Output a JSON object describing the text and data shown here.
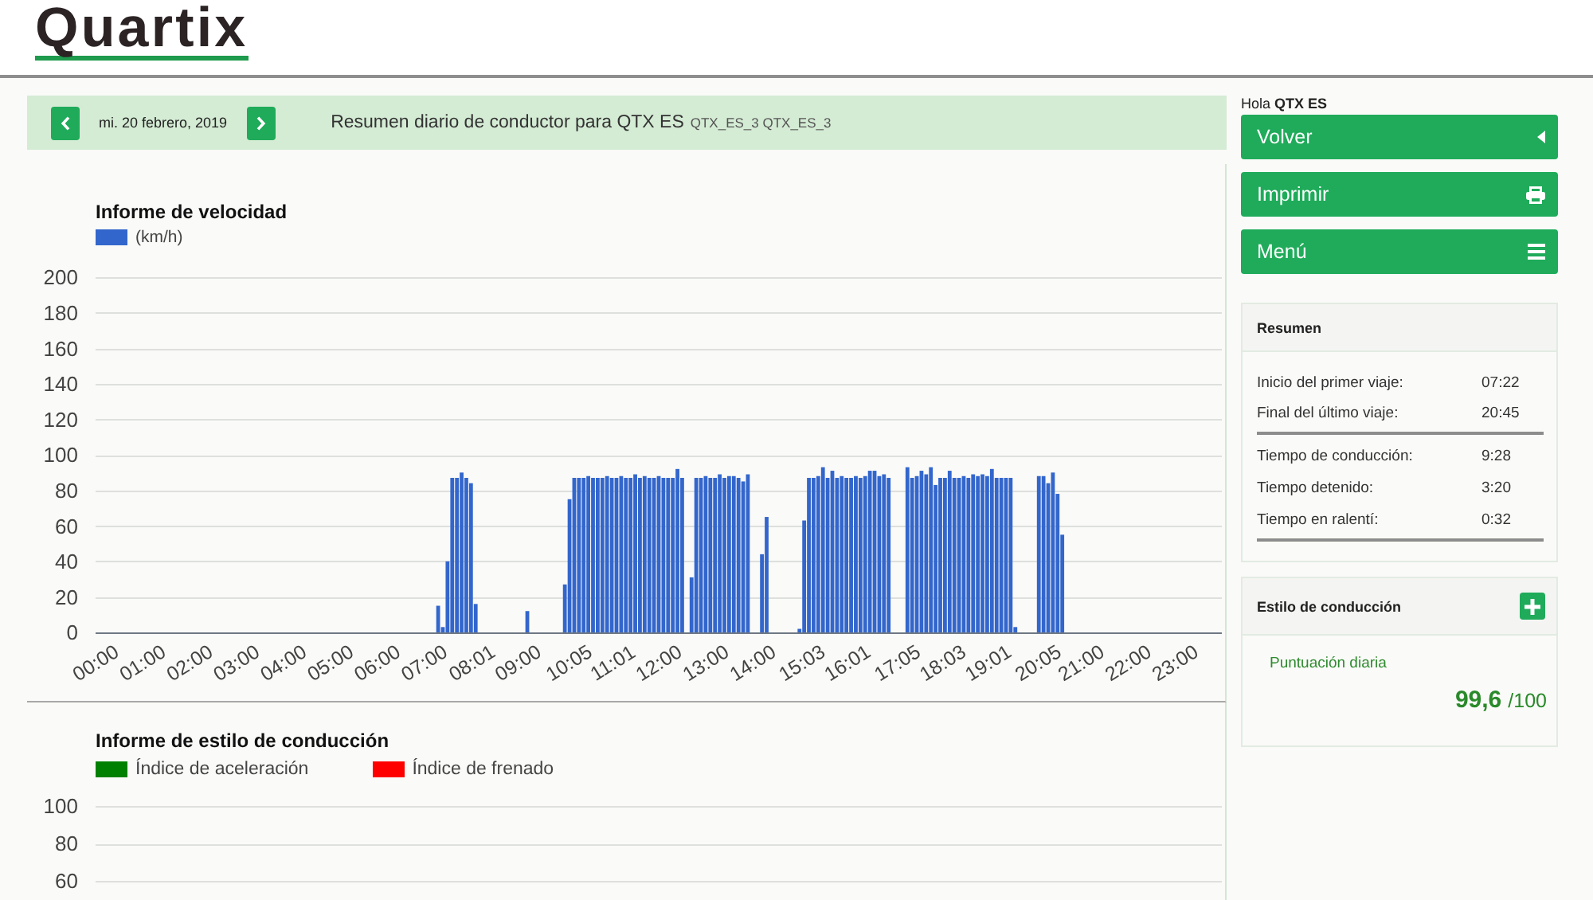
{
  "header": {
    "logo": "Quartix"
  },
  "day_bar": {
    "date": "mi. 20 febrero, 2019",
    "title": "Resumen diario de conductor para QTX ES",
    "subtitle": "QTX_ES_3 QTX_ES_3"
  },
  "speed_chart": {
    "chart_data": {
      "type": "bar",
      "title": "Informe de velocidad",
      "x": [
        7.3,
        7.4,
        7.5,
        7.6,
        7.7,
        7.8,
        7.9,
        8.0,
        8.1,
        9.2,
        10.0,
        10.1,
        10.2,
        10.3,
        10.4,
        10.5,
        10.6,
        10.7,
        10.8,
        10.9,
        11.0,
        11.1,
        11.2,
        11.3,
        11.4,
        11.5,
        11.6,
        11.7,
        11.8,
        11.9,
        12.0,
        12.1,
        12.2,
        12.3,
        12.4,
        12.5,
        12.7,
        12.8,
        12.9,
        13.0,
        13.1,
        13.2,
        13.3,
        13.4,
        13.5,
        13.6,
        13.7,
        13.8,
        13.9,
        14.2,
        14.3,
        15.0,
        15.1,
        15.2,
        15.3,
        15.4,
        15.5,
        15.6,
        15.7,
        15.8,
        15.9,
        16.0,
        16.1,
        16.2,
        16.3,
        16.4,
        16.5,
        16.6,
        16.7,
        16.8,
        16.9,
        17.3,
        17.4,
        17.5,
        17.6,
        17.7,
        17.8,
        17.9,
        18.0,
        18.1,
        18.2,
        18.3,
        18.4,
        18.5,
        18.6,
        18.7,
        18.8,
        18.9,
        19.0,
        19.1,
        19.2,
        19.3,
        19.4,
        19.5,
        19.6,
        20.1,
        20.2,
        20.3,
        20.4,
        20.5,
        20.6
      ],
      "series": [
        {
          "name": "(km/h)",
          "color": "#3366cc",
          "values": [
            15,
            3,
            40,
            87,
            87,
            90,
            87,
            84,
            16,
            12,
            27,
            75,
            87,
            87,
            87,
            88,
            87,
            87,
            87,
            88,
            87,
            87,
            88,
            87,
            87,
            89,
            87,
            88,
            87,
            87,
            88,
            87,
            87,
            87,
            92,
            87,
            31,
            87,
            87,
            88,
            87,
            87,
            89,
            87,
            88,
            88,
            87,
            85,
            89,
            44,
            65,
            2,
            63,
            87,
            87,
            88,
            93,
            87,
            91,
            87,
            88,
            87,
            87,
            88,
            87,
            88,
            91,
            91,
            88,
            89,
            87,
            93,
            87,
            88,
            91,
            89,
            93,
            83,
            87,
            87,
            91,
            87,
            87,
            88,
            87,
            89,
            88,
            89,
            88,
            92,
            87,
            87,
            87,
            87,
            3,
            88,
            88,
            84,
            90,
            78,
            55
          ]
        }
      ],
      "xlim": [
        0,
        24
      ],
      "ylim": [
        0,
        200
      ],
      "grid": true,
      "xticks": [
        {
          "value": 0,
          "label": "00:00"
        },
        {
          "value": 1,
          "label": "01:00"
        },
        {
          "value": 2,
          "label": "02:00"
        },
        {
          "value": 3,
          "label": "03:00"
        },
        {
          "value": 4,
          "label": "04:00"
        },
        {
          "value": 5,
          "label": "05:00"
        },
        {
          "value": 6,
          "label": "06:00"
        },
        {
          "value": 7,
          "label": "07:00"
        },
        {
          "value": 8.017,
          "label": "08:01"
        },
        {
          "value": 9,
          "label": "09:00"
        },
        {
          "value": 10.083,
          "label": "10:05"
        },
        {
          "value": 11.017,
          "label": "11:01"
        },
        {
          "value": 12,
          "label": "12:00"
        },
        {
          "value": 13,
          "label": "13:00"
        },
        {
          "value": 14,
          "label": "14:00"
        },
        {
          "value": 15.05,
          "label": "15:03"
        },
        {
          "value": 16.017,
          "label": "16:01"
        },
        {
          "value": 17.083,
          "label": "17:05"
        },
        {
          "value": 18.05,
          "label": "18:03"
        },
        {
          "value": 19.017,
          "label": "19:01"
        },
        {
          "value": 20.083,
          "label": "20:05"
        },
        {
          "value": 21,
          "label": "21:00"
        },
        {
          "value": 22,
          "label": "22:00"
        },
        {
          "value": 23,
          "label": "23:00"
        }
      ],
      "yticks": [
        0,
        20,
        40,
        60,
        80,
        100,
        120,
        140,
        160,
        180,
        200
      ]
    }
  },
  "style_chart": {
    "chart_data": {
      "type": "bar",
      "title": "Informe de estilo de conducción",
      "series": [
        {
          "name": "Índice de aceleración",
          "color": "#008000"
        },
        {
          "name": "Índice de frenado",
          "color": "#ff0000"
        }
      ],
      "ylim": [
        60,
        100
      ],
      "grid": true,
      "yticks": [
        60,
        80,
        100
      ]
    }
  },
  "sidebar": {
    "greeting": "Hola **QTX ES**",
    "buttons": [
      {
        "label": "Volver"
      },
      {
        "label": "Imprimir"
      },
      {
        "label": "Menú"
      }
    ],
    "summary": {
      "title": "Resumen",
      "groups": [
        {
          "rows": [
            {
              "label": "Inicio del primer viaje:",
              "value": "07:22"
            },
            {
              "label": "Final del último viaje:",
              "value": "20:45"
            }
          ]
        },
        {
          "rows": [
            {
              "label": "Tiempo de conducción:",
              "value": "9:28"
            },
            {
              "label": "Tiempo detenido:",
              "value": "3:20"
            },
            {
              "label": "Tiempo en ralentí:",
              "value": "0:32"
            }
          ]
        }
      ]
    },
    "driving_style": {
      "title": "Estilo de conducción",
      "score_label": "Puntuación diaria",
      "score": "99,6",
      "score_max": "/100"
    }
  }
}
